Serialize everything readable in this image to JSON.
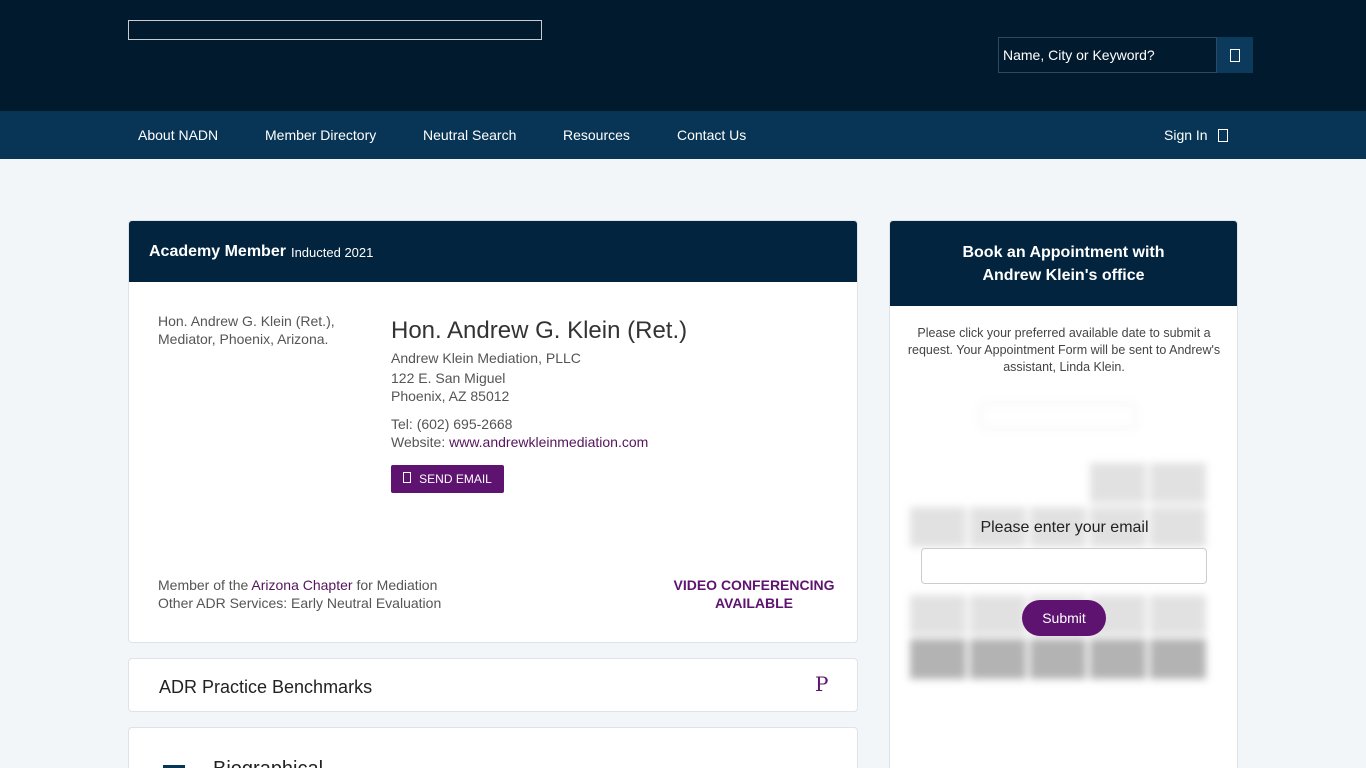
{
  "header": {
    "search": {
      "placeholder": "Name, City or Keyword?",
      "button_icon": "search-icon"
    }
  },
  "nav": {
    "items": [
      {
        "label": "About NADN"
      },
      {
        "label": "Member Directory"
      },
      {
        "label": "Neutral Search"
      },
      {
        "label": "Resources"
      },
      {
        "label": "Contact Us"
      }
    ],
    "signin_label": "Sign In"
  },
  "profile": {
    "header_main": "Academy Member",
    "header_sub": "Inducted 2021",
    "photo_alt": "Hon. Andrew G. Klein (Ret.), Mediator, Phoenix, Arizona.",
    "name": "Hon. Andrew G. Klein (Ret.)",
    "firm": "Andrew Klein Mediation, PLLC",
    "address_line1": "122 E. San Miguel",
    "address_line2": "Phoenix, AZ 85012",
    "tel_label": "Tel:",
    "tel": "(602) 695-2668",
    "website_label": "Website:",
    "website": "www.andrewkleinmediation.com",
    "email_button": "SEND EMAIL",
    "member_prefix": "Member of the",
    "chapter": "Arizona Chapter",
    "member_suffix": "for Mediation",
    "other_services": "Other ADR Services: Early Neutral Evaluation",
    "video_line1": "VIDEO CONFERENCING",
    "video_line2": "AVAILABLE"
  },
  "benchmarks": {
    "title": "ADR Practice Benchmarks",
    "icon_glyph": "P"
  },
  "bio": {
    "title": "Biographical"
  },
  "booking": {
    "title_line1": "Book an Appointment with",
    "title_line2": "Andrew Klein's office",
    "instructions": "Please click your preferred available date to submit a request. Your Appointment Form will be sent to Andrew's assistant, Linda Klein.",
    "email_prompt": "Please enter your email",
    "submit_label": "Submit"
  }
}
